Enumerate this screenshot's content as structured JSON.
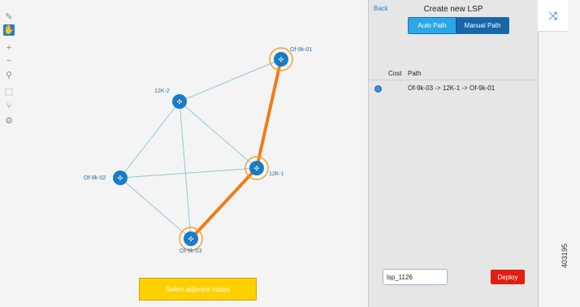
{
  "toolbar": {
    "tools": [
      {
        "icon": "edit-icon",
        "glyph": "✎",
        "active": false
      },
      {
        "icon": "pan-hand-icon",
        "glyph": "✋",
        "active": true
      },
      {
        "icon": "zoom-in-icon",
        "glyph": "+",
        "active": false
      },
      {
        "icon": "zoom-out-icon",
        "glyph": "−",
        "active": false
      },
      {
        "icon": "zoom-fit-icon",
        "glyph": "⚲",
        "active": false
      },
      {
        "icon": "fit-selection-icon",
        "glyph": "⬚",
        "active": false
      },
      {
        "icon": "layout-icon",
        "glyph": "⑂",
        "active": false
      },
      {
        "icon": "settings-gear-icon",
        "glyph": "⚙",
        "active": false
      }
    ]
  },
  "topology": {
    "nodes": [
      {
        "id": "of9k01",
        "label": "Of-9k-01",
        "selected": true
      },
      {
        "id": "12k2",
        "label": "12K-2",
        "selected": false
      },
      {
        "id": "12k1",
        "label": "12K-1",
        "selected": true
      },
      {
        "id": "of9k02",
        "label": "Of-9k-02",
        "selected": false
      },
      {
        "id": "of9k03",
        "label": "Of-9k-03",
        "selected": true
      }
    ],
    "links": [
      [
        "12k2",
        "of9k01"
      ],
      [
        "12k2",
        "of9k02"
      ],
      [
        "12k2",
        "12k1"
      ],
      [
        "12k2",
        "of9k03"
      ],
      [
        "of9k02",
        "12k1"
      ],
      [
        "of9k02",
        "of9k03"
      ],
      [
        "of9k01",
        "12k1"
      ],
      [
        "12k1",
        "of9k03"
      ]
    ],
    "highlighted_path": [
      "of9k03",
      "12k1",
      "of9k01"
    ],
    "colors": {
      "link": "#8ec9d8",
      "highlight": "#f07c1b",
      "node": "#1a7cc4",
      "selection_ring": "#f0a030"
    }
  },
  "select_button": {
    "label": "Select adjacent nodes"
  },
  "panel": {
    "back_label": "Back",
    "title": "Create new LSP",
    "mode_auto": "Auto Path",
    "mode_manual": "Manual Path",
    "table": {
      "header_cost": "Cost",
      "header_path": "Path",
      "rows": [
        {
          "path": "Of-9k-03 -> 12K-1 -> Of-9k-01"
        }
      ]
    },
    "lsp_name_value": "lsp_1126",
    "deploy_label": "Deploy"
  },
  "right_button": {
    "icon": "shuffle-icon"
  },
  "watermark": "403195"
}
